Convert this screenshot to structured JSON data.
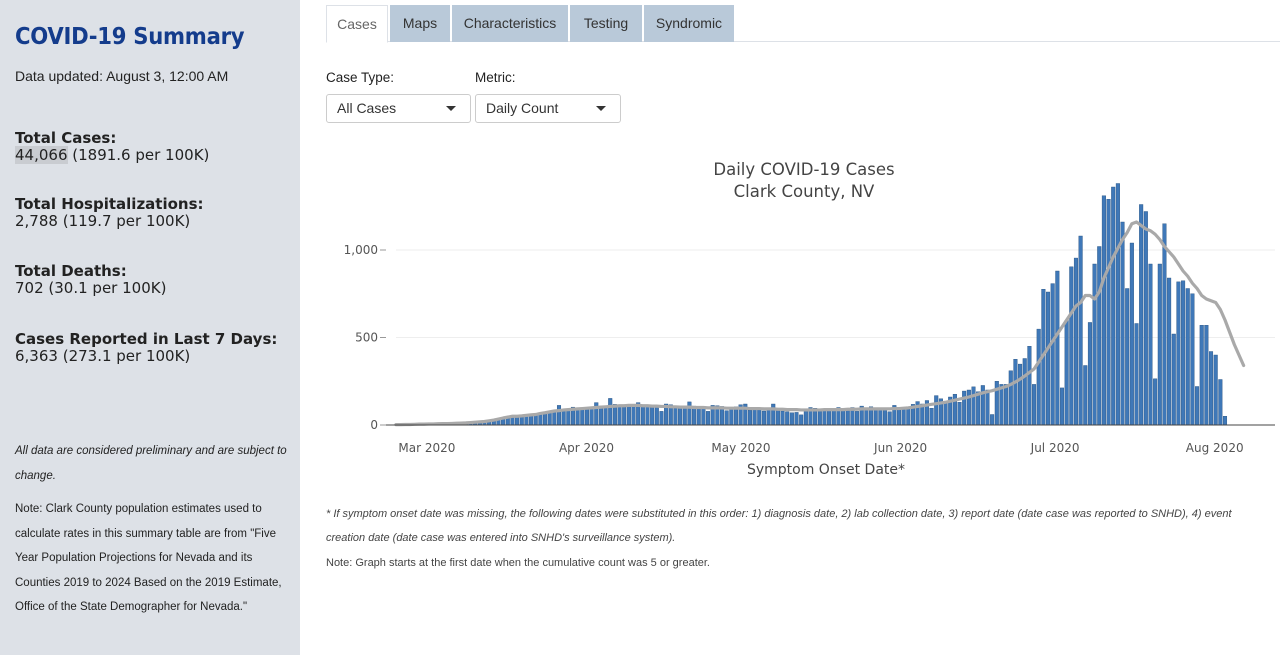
{
  "sidebar": {
    "title": "COVID-19 Summary",
    "updated": "Data updated: August 3, 12:00 AM",
    "stats": [
      {
        "label": "Total Cases:",
        "value_main": "44,066",
        "value_rest": " (1891.6 per 100K)"
      },
      {
        "label": "Total Hospitalizations:",
        "value_main": "2,788",
        "value_rest": " (119.7 per 100K)"
      },
      {
        "label": "Total Deaths:",
        "value_main": "702",
        "value_rest": " (30.1 per 100K)"
      },
      {
        "label": "Cases Reported in Last 7 Days:",
        "value_main": "6,363",
        "value_rest": " (273.1 per 100K)"
      }
    ],
    "note_preliminary": "All data are considered preliminary and are subject to change.",
    "note_population": "Note: Clark County population estimates used to calculate rates in this summary table are from \"Five Year Population Projections for Nevada and its Counties 2019 to 2024 Based on the 2019 Estimate, Office of the State Demographer for Nevada.\""
  },
  "tabs": [
    {
      "label": "Cases",
      "active": true
    },
    {
      "label": "Maps",
      "active": false
    },
    {
      "label": "Characteristics",
      "active": false
    },
    {
      "label": "Testing",
      "active": false
    },
    {
      "label": "Syndromic",
      "active": false
    }
  ],
  "controls": {
    "case_type_label": "Case Type:",
    "case_type_value": "All Cases",
    "metric_label": "Metric:",
    "metric_value": "Daily Count"
  },
  "colors": {
    "bar": "#3f78b8",
    "bar_edge": "#25507f",
    "moving_average": "#a9a9a9",
    "sidebar_bg": "#dde1e7",
    "title_blue": "#143c8c",
    "tab_bg": "#b9c9d9"
  },
  "chart_data": {
    "type": "bar",
    "title": "Daily COVID-19 Cases",
    "subtitle": "Clark County, NV",
    "xlabel": "Symptom Onset Date*",
    "ylabel": "",
    "x_start": "2020-02-24",
    "x_end": "2020-08-03",
    "x_tick_dates": [
      "2020-03-01",
      "2020-04-01",
      "2020-05-01",
      "2020-06-01",
      "2020-07-01",
      "2020-08-01"
    ],
    "x_tick_labels": [
      "Mar 2020",
      "Apr 2020",
      "May 2020",
      "Jun 2020",
      "Jul 2020",
      "Aug 2020"
    ],
    "ylim": [
      0,
      1400
    ],
    "y_ticks": [
      0,
      500,
      1000
    ],
    "y_tick_labels": [
      "0",
      "500",
      "1,000"
    ],
    "grid": true,
    "series": [
      {
        "values": [
          2,
          2,
          3,
          3,
          4,
          5,
          5,
          6,
          6,
          7,
          8,
          8,
          9,
          10,
          11,
          12,
          14,
          16,
          18,
          20,
          24,
          28,
          34,
          40,
          45,
          50,
          46,
          52,
          55,
          58,
          60,
          66,
          70,
          75,
          80,
          112,
          86,
          90,
          102,
          96,
          88,
          98,
          100,
          128,
          108,
          98,
          152,
          118,
          108,
          102,
          112,
          110,
          128,
          116,
          108,
          104,
          108,
          78,
          120,
          116,
          95,
          100,
          104,
          132,
          108,
          98,
          94,
          78,
          112,
          110,
          106,
          82,
          96,
          104,
          116,
          120,
          84,
          94,
          96,
          80,
          86,
          120,
          88,
          80,
          76,
          70,
          72,
          58,
          92,
          100,
          96,
          78,
          90,
          84,
          88,
          100,
          82,
          92,
          100,
          78,
          108,
          86,
          104,
          86,
          94,
          88,
          76,
          112,
          88,
          98,
          92,
          118,
          134,
          120,
          140,
          96,
          168,
          150,
          124,
          160,
          176,
          130,
          194,
          200,
          218,
          190,
          226,
          200,
          60,
          250,
          232,
          232,
          310,
          376,
          348,
          380,
          450,
          232,
          548,
          776,
          760,
          808,
          880,
          212,
          598,
          904,
          954,
          1080,
          340,
          586,
          920,
          1020,
          1310,
          1290,
          1360,
          1380,
          1160,
          780,
          1040,
          580,
          1260,
          1220,
          920,
          264,
          920,
          1150,
          840,
          520,
          818,
          824,
          780,
          750,
          220,
          570,
          570,
          420,
          400,
          260,
          50
        ],
        "moving_average": [
          2,
          2,
          3,
          3,
          4,
          5,
          5,
          6,
          6,
          7,
          8,
          8,
          9,
          10,
          11,
          12,
          14,
          16,
          18,
          20,
          24,
          28,
          34,
          40,
          45,
          50,
          50,
          52,
          55,
          58,
          60,
          66,
          70,
          75,
          80,
          82,
          86,
          88,
          90,
          92,
          94,
          96,
          98,
          100,
          102,
          104,
          106,
          108,
          110,
          110,
          112,
          112,
          112,
          110,
          110,
          108,
          108,
          106,
          106,
          104,
          104,
          102,
          102,
          102,
          100,
          100,
          100,
          98,
          98,
          98,
          98,
          96,
          96,
          96,
          96,
          96,
          94,
          94,
          94,
          92,
          92,
          92,
          90,
          90,
          88,
          88,
          88,
          86,
          86,
          86,
          86,
          86,
          88,
          88,
          88,
          88,
          88,
          90,
          90,
          90,
          92,
          92,
          92,
          92,
          92,
          92,
          92,
          94,
          94,
          96,
          98,
          102,
          106,
          110,
          114,
          118,
          122,
          126,
          130,
          136,
          142,
          148,
          154,
          160,
          168,
          176,
          184,
          190,
          196,
          204,
          212,
          220,
          232,
          246,
          262,
          280,
          300,
          320,
          360,
          400,
          440,
          480,
          520,
          560,
          600,
          640,
          680,
          700,
          740,
          740,
          720,
          760,
          840,
          900,
          960,
          1010,
          1060,
          1100,
          1150,
          1160,
          1140,
          1120,
          1110,
          1090,
          1060,
          1020,
          990,
          960,
          920,
          880,
          850,
          810,
          780,
          740,
          720,
          710,
          700,
          660,
          600,
          530,
          460,
          400,
          340
        ]
      }
    ]
  },
  "footnotes": {
    "substitution": "* If symptom onset date was missing, the following dates were substituted in this order: 1) diagnosis date, 2) lab collection date, 3) report date (date case was reported to SNHD), 4) event creation date (date case was entered into SNHD's surveillance system).",
    "start": "Note: Graph starts at the first date when the cumulative count was 5 or greater."
  }
}
